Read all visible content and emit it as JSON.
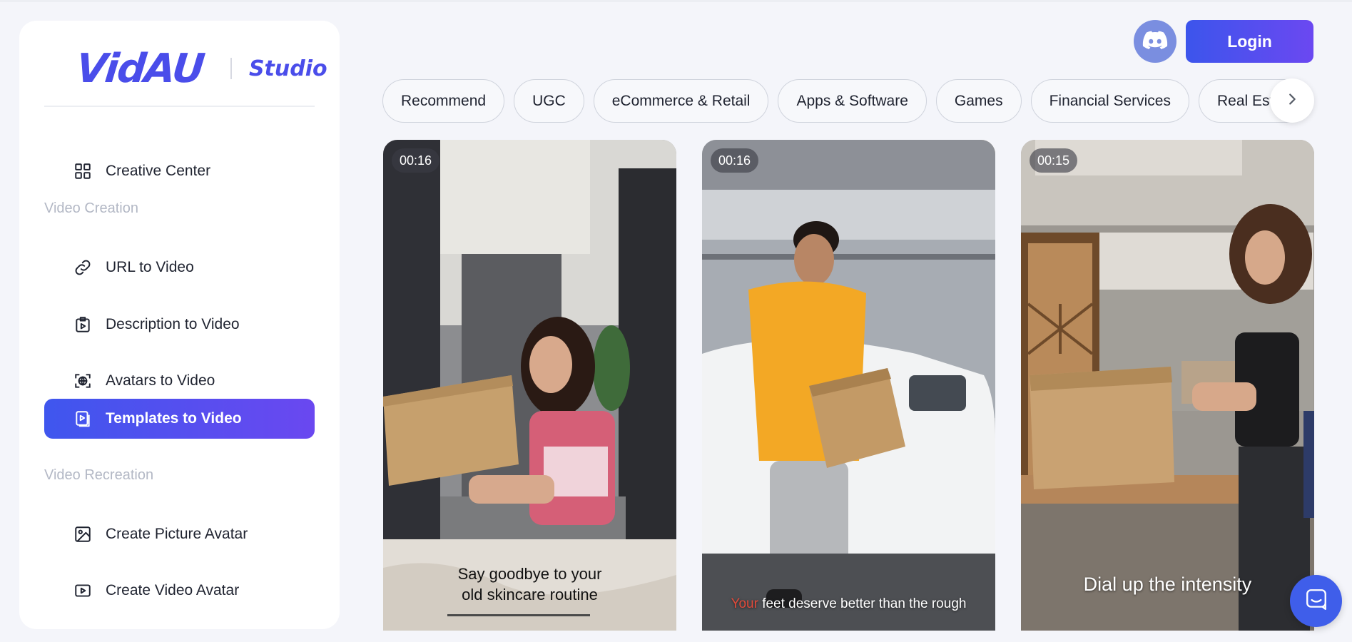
{
  "brand": {
    "logo": "VidAU",
    "product": "Studio"
  },
  "sidebar": {
    "top_item": {
      "label": "Creative Center",
      "icon": "grid-icon"
    },
    "sections": [
      {
        "title": "Video Creation",
        "items": [
          {
            "label": "URL to Video",
            "icon": "link-icon",
            "active": false
          },
          {
            "label": "Description to Video",
            "icon": "clipboard-play-icon",
            "active": false
          },
          {
            "label": "Avatars to Video",
            "icon": "avatar-scan-icon",
            "active": false
          },
          {
            "label": "Templates to Video",
            "icon": "template-icon",
            "active": true
          }
        ]
      },
      {
        "title": "Video Recreation",
        "items": [
          {
            "label": "Create Picture Avatar",
            "icon": "image-icon",
            "active": false
          },
          {
            "label": "Create Video Avatar",
            "icon": "video-icon",
            "active": false
          }
        ]
      }
    ]
  },
  "header": {
    "login_label": "Login",
    "discord_icon": "discord-icon"
  },
  "categories": [
    "Recommend",
    "UGC",
    "eCommerce & Retail",
    "Apps & Software",
    "Games",
    "Financial Services",
    "Real Estate"
  ],
  "videos": [
    {
      "duration": "00:16",
      "caption": "Say goodbye to your\nold skincare routine"
    },
    {
      "duration": "00:16",
      "caption_highlight": "Your",
      "caption": " feet deserve better than the rough"
    },
    {
      "duration": "00:15",
      "caption": "Dial up the intensity"
    }
  ],
  "colors": {
    "accent": "#4a4dea",
    "active_gradient_start": "#3f56ee",
    "active_gradient_end": "#6a48f0",
    "chat_button": "#3f5eea"
  }
}
